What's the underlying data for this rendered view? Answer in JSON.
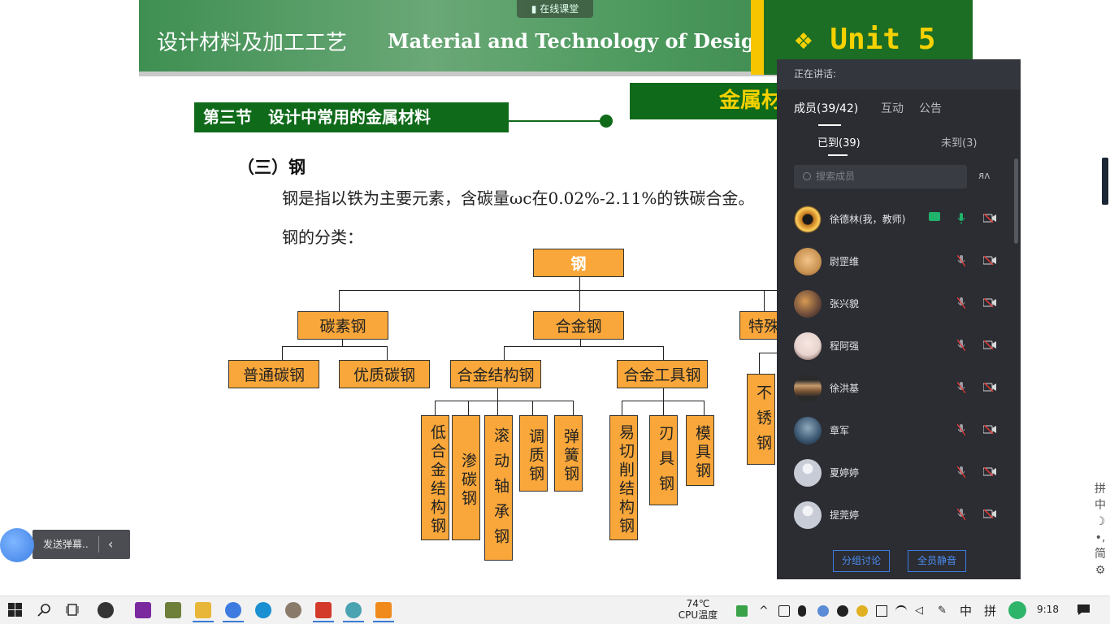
{
  "slide": {
    "title_cn": "设计材料及加工工艺",
    "title_en": "Material and Technology of Design",
    "unit": "❖ Unit 5",
    "live_tag": "在线课堂",
    "section": "第三节　设计中常用的金属材料",
    "metal_box": "金属材",
    "sub_title": "（三）钢",
    "definition": "钢是指以铁为主要元素，含碳量ωc在0.02%-2.11%的铁碳合金。",
    "classification": "钢的分类："
  },
  "tree": {
    "root": "钢",
    "level1": [
      "碳素钢",
      "合金钢",
      "特殊"
    ],
    "carbon": [
      "普通碳钢",
      "优质碳钢"
    ],
    "alloy": [
      "合金结构钢",
      "合金工具钢"
    ],
    "alloy_structural": [
      "低合金结构钢",
      "渗碳钢",
      "滚动轴承钢",
      "调质钢",
      "弹簧钢"
    ],
    "alloy_tool": [
      "易切削结构钢",
      "刃具钢",
      "模具钢"
    ],
    "special": [
      "不锈钢"
    ]
  },
  "panel": {
    "header": "正在讲话:",
    "tabs": [
      "成员(39/42)",
      "互动",
      "公告"
    ],
    "subtabs": [
      "已到(39)",
      "未到(3)"
    ],
    "search_placeholder": "搜索成员",
    "members": [
      {
        "name": "徐德林(我，教师)",
        "avatar_color": "#c2761d"
      },
      {
        "name": "尉罡维",
        "avatar_color": "#c99352"
      },
      {
        "name": "张兴貌",
        "avatar_color": "#6b4a3a"
      },
      {
        "name": "程阿强",
        "avatar_color": "#e8d4cf"
      },
      {
        "name": "徐洪基",
        "avatar_color": "#5a4a3c"
      },
      {
        "name": "章军",
        "avatar_color": "#3a5670"
      },
      {
        "name": "夏婷婷",
        "avatar_color": "#c8ccd6"
      },
      {
        "name": "提莞婷",
        "avatar_color": "#c8ccd6"
      }
    ],
    "buttons": [
      "分组讨论",
      "全员静音"
    ]
  },
  "danmaku": {
    "placeholder": "发送弹幕.."
  },
  "ime_side": [
    "拼",
    "中",
    "☽",
    "•,",
    "简",
    "⚙"
  ],
  "taskbar": {
    "temp": "74℃",
    "temp_label": "CPU温度",
    "lang": "中",
    "ime": "拼",
    "time": "9:18"
  },
  "colors": {
    "slide_green": "#0f6a1a",
    "node_orange": "#f9a73a",
    "panel_bg": "#2b2d33",
    "unit_yellow": "#f5d100"
  }
}
